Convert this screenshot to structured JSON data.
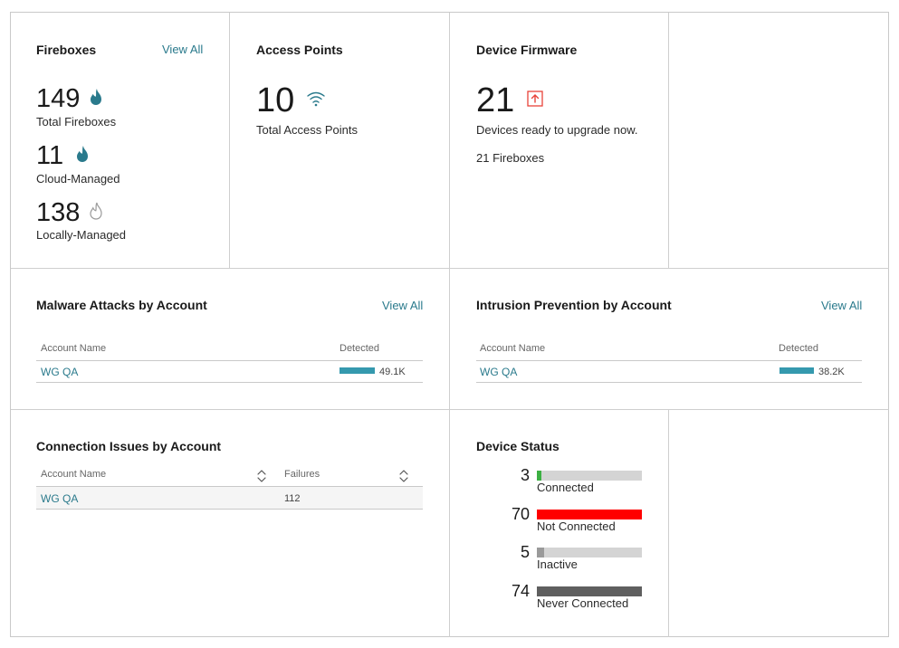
{
  "fireboxes": {
    "title": "Fireboxes",
    "view_all": "View All",
    "total": {
      "value": "149",
      "label": "Total Fireboxes"
    },
    "cloud": {
      "value": "11",
      "label": "Cloud-Managed"
    },
    "local": {
      "value": "138",
      "label": "Locally-Managed"
    }
  },
  "access_points": {
    "title": "Access Points",
    "value": "10",
    "label": "Total Access Points"
  },
  "firmware": {
    "title": "Device Firmware",
    "value": "21",
    "label": "Devices ready to upgrade now.",
    "detail": "21 Fireboxes"
  },
  "malware": {
    "title": "Malware Attacks by Account",
    "view_all": "View All",
    "columns": [
      "Account Name",
      "Detected"
    ],
    "rows": [
      {
        "account": "WG QA",
        "detected": "49.1K"
      }
    ]
  },
  "intrusion": {
    "title": "Intrusion Prevention by Account",
    "view_all": "View All",
    "columns": [
      "Account Name",
      "Detected"
    ],
    "rows": [
      {
        "account": "WG QA",
        "detected": "38.2K"
      }
    ]
  },
  "connection": {
    "title": "Connection Issues by Account",
    "columns": [
      "Account Name",
      "Failures"
    ],
    "rows": [
      {
        "account": "WG QA",
        "failures": "112"
      }
    ]
  },
  "device_status": {
    "title": "Device Status",
    "items": [
      {
        "value": "3",
        "label": "Connected",
        "fraction": 0.04,
        "color": "#3cb043"
      },
      {
        "value": "70",
        "label": "Not Connected",
        "fraction": 1.0,
        "color": "#ff0000"
      },
      {
        "value": "5",
        "label": "Inactive",
        "fraction": 0.07,
        "color": "#9a9a9a"
      },
      {
        "value": "74",
        "label": "Never Connected",
        "fraction": 1.0,
        "color": "#5f5f5f"
      }
    ]
  },
  "colors": {
    "accent": "#2a7a8c",
    "bar": "#3599ae",
    "upgrade": "#e8433a"
  }
}
